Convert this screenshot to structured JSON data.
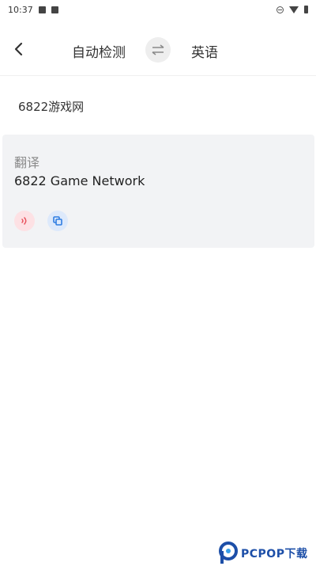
{
  "status_bar": {
    "time": "10:37"
  },
  "header": {
    "source_language": "自动检测",
    "target_language": "英语"
  },
  "input": {
    "text": "6822游戏网"
  },
  "result": {
    "label": "翻译",
    "text": "6822 Game Network"
  },
  "icons": {
    "back": "chevron-left-icon",
    "swap": "swap-arrows-icon",
    "speak": "speaker-icon",
    "copy": "copy-icon"
  },
  "colors": {
    "card_background": "#f2f3f5",
    "speak_background": "#fde1e4",
    "speak_accent": "#e8505b",
    "copy_background": "#dde9fb",
    "copy_accent": "#2f7de1",
    "watermark": "#1d4fa8"
  },
  "watermark": {
    "text": "PCPOP下载"
  }
}
